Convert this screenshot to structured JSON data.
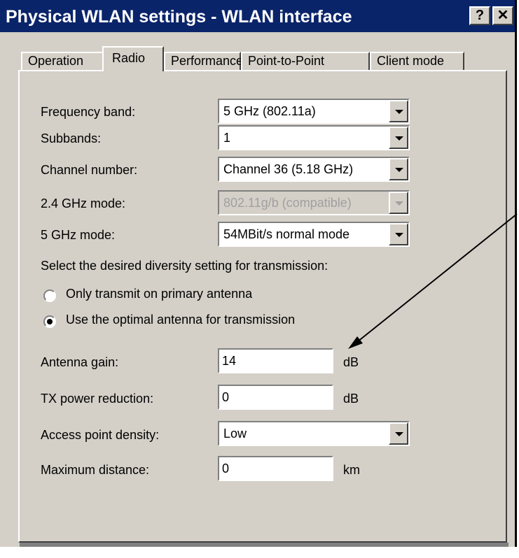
{
  "window": {
    "title": "Physical WLAN settings - WLAN interface",
    "help_button": "?",
    "close_button": "✕"
  },
  "tabs": [
    {
      "label": "Operation",
      "active": false
    },
    {
      "label": "Radio",
      "active": true
    },
    {
      "label": "Performance",
      "active": false
    },
    {
      "label": "Point-to-Point",
      "active": false
    },
    {
      "label": "Client mode",
      "active": false
    }
  ],
  "radio_tab": {
    "frequency_band": {
      "label": "Frequency band:",
      "value": "5 GHz (802.11a)"
    },
    "subbands": {
      "label": "Subbands:",
      "value": "1"
    },
    "channel_number": {
      "label": "Channel number:",
      "value": "Channel 36 (5.18 GHz)"
    },
    "mode_24": {
      "label": "2.4 GHz mode:",
      "value": "802.11g/b (compatible)",
      "disabled": true
    },
    "mode_5": {
      "label": "5 GHz mode:",
      "value": "54MBit/s normal mode"
    },
    "diversity_prompt": "Select the desired diversity setting for transmission:",
    "diversity_options": [
      {
        "label": "Only transmit on primary antenna",
        "checked": false
      },
      {
        "label": "Use the optimal antenna for transmission",
        "checked": true
      }
    ],
    "antenna_gain": {
      "label": "Antenna gain:",
      "value": "14",
      "unit": "dB"
    },
    "tx_power_reduction": {
      "label": "TX power reduction:",
      "value": "0",
      "unit": "dB"
    },
    "access_point_density": {
      "label": "Access point density:",
      "value": "Low"
    },
    "maximum_distance": {
      "label": "Maximum distance:",
      "value": "0",
      "unit": "km"
    }
  },
  "colors": {
    "title_bar": "#0a246a",
    "dialog_face": "#d4d0c8",
    "arrow": "#000000"
  }
}
